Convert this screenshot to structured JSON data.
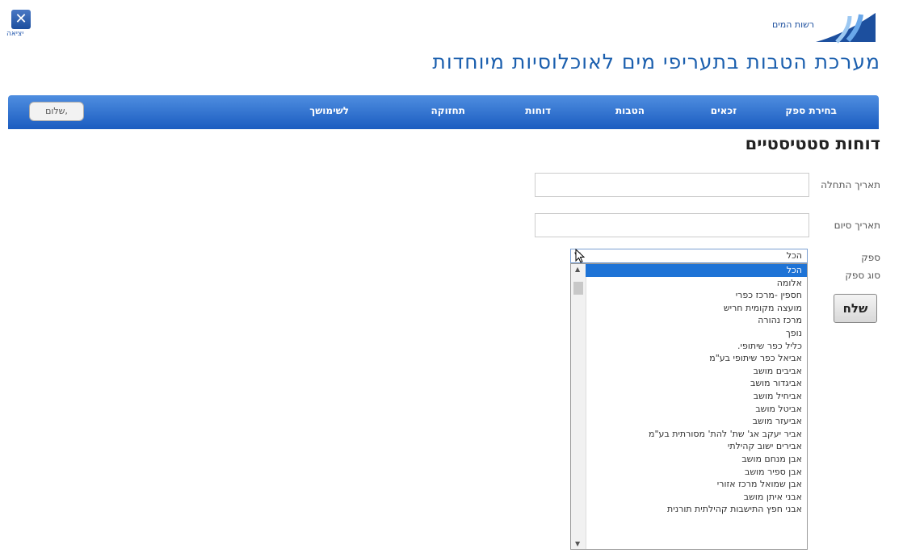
{
  "exit": {
    "icon": "close-icon",
    "label": "יציאה"
  },
  "logo": {
    "text": "רשות המים"
  },
  "app_title": "מערכת הטבות בתעריפי מים לאוכלוסיות מיוחדות",
  "nav": {
    "items": [
      "בחירת ספק",
      "זכאים",
      "הטבות",
      "דוחות",
      "תחזוקה",
      "לשימושך"
    ],
    "greeting": "שלום,"
  },
  "page_title": "דוחות סטטיסטיים",
  "form": {
    "start_date_label": "תאריך התחלה",
    "end_date_label": "תאריך סיום",
    "supplier_label": "ספק",
    "supplier_type_label": "סוג ספק",
    "supplier_selected": "הכל",
    "submit_label": "שלח"
  },
  "supplier_options": [
    "הכל",
    "אלומה",
    "חספין -מרכז כפרי",
    "מועצה מקומית חריש",
    "מרכז נהורה",
    "נופך",
    "כליל כפר שיתופי.",
    "אביאל כפר שיתופי בע\"מ",
    "אביבים מושב",
    "אביגדור מושב",
    "אביחיל מושב",
    "אביטל מושב",
    "אביעזר מושב",
    "אביר יעקב אג' שת' להת' מסורתית בע\"מ",
    "אבירים ישוב קהילתי",
    "אבן מנחם מושב",
    "אבן ספיר מושב",
    "אבן שמואל מרכז אזורי",
    "אבני איתן מושב",
    "אבני חפץ התישבות קהילתית תורנית"
  ],
  "colors": {
    "nav_bg": "#1b5cc0",
    "title": "#1b5fae",
    "selected": "#1e73d6"
  }
}
